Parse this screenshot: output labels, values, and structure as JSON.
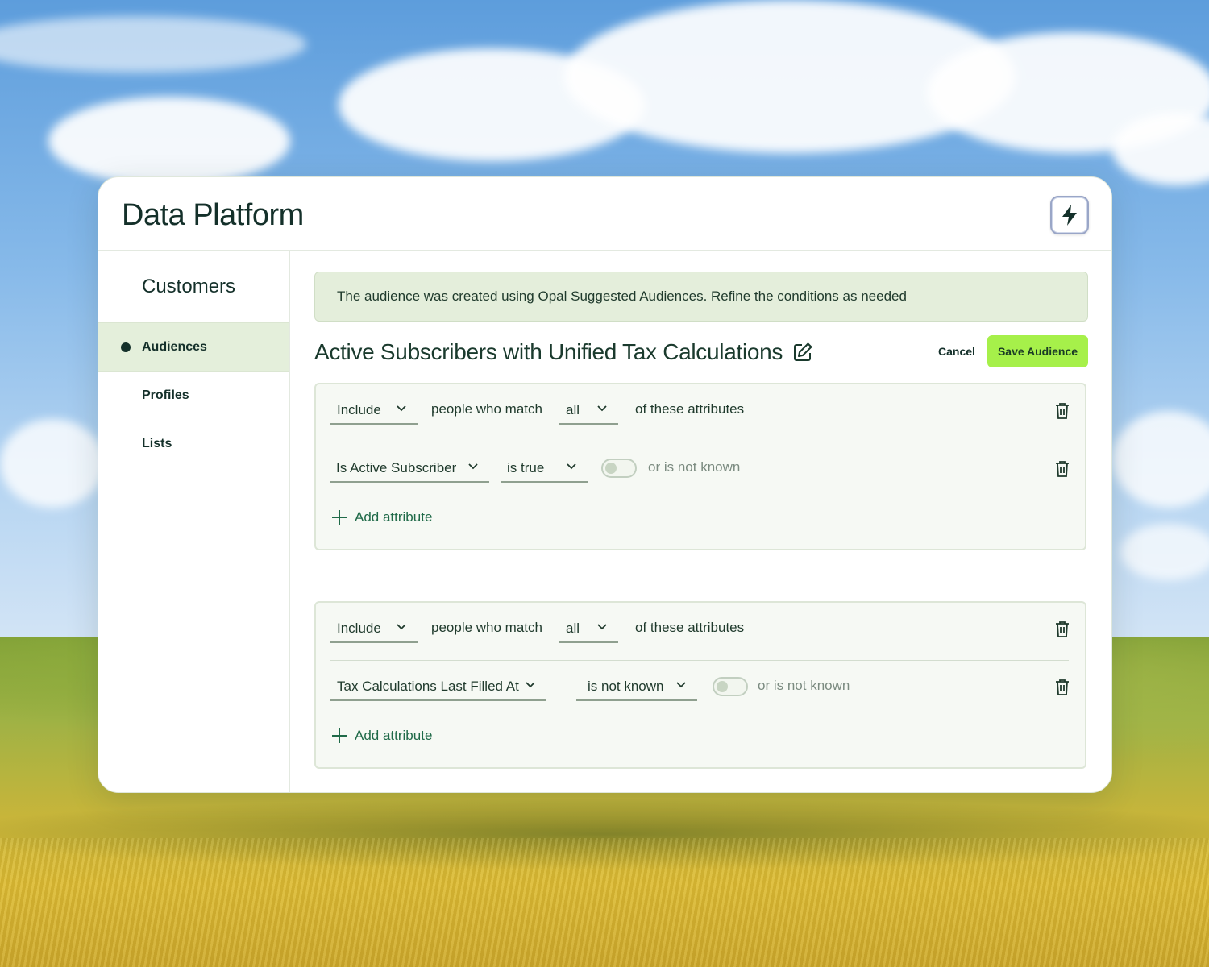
{
  "app": {
    "title": "Data Platform",
    "action_icon": "lightning-bolt-icon"
  },
  "sidebar": {
    "title": "Customers",
    "items": [
      {
        "label": "Audiences",
        "active": true
      },
      {
        "label": "Profiles",
        "active": false
      },
      {
        "label": "Lists",
        "active": false
      }
    ]
  },
  "banner": {
    "text": "The audience was created using Opal Suggested Audiences. Refine the conditions as needed"
  },
  "audience": {
    "title": "Active Subscribers with Unified Tax Calculations",
    "cancel_label": "Cancel",
    "save_label": "Save Audience"
  },
  "groups": [
    {
      "mode": "Include",
      "match_prefix": "people who match",
      "match": "all",
      "match_suffix": "of these attributes",
      "condition": {
        "attribute": "Is Active Subscriber",
        "operator": "is true",
        "toggle_label": "or is not known",
        "toggle_on": false
      },
      "add_label": "Add attribute"
    },
    {
      "mode": "Include",
      "match_prefix": "people who match",
      "match": "all",
      "match_suffix": "of these attributes",
      "condition": {
        "attribute": "Tax Calculations Last Filled At",
        "operator": "is not known",
        "toggle_label": "or is not known",
        "toggle_on": false
      },
      "add_label": "Add attribute"
    }
  ],
  "colors": {
    "accent": "#a6f04a",
    "active_nav": "#e4efdb",
    "banner": "#e4eedb",
    "link": "#1f6a48"
  }
}
